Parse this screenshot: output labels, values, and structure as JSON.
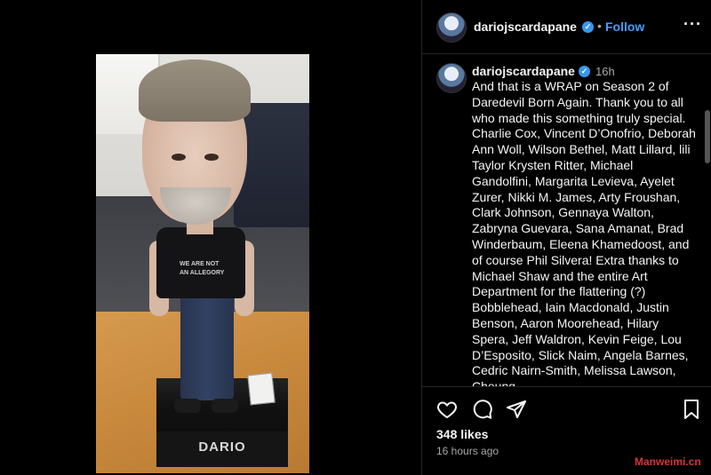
{
  "post": {
    "username": "dariojscardapane",
    "follow_label": "Follow",
    "separator": "•",
    "caption_time": "16h",
    "caption": "And that is a WRAP on Season 2 of Daredevil Born Again.  Thank you to all who made this something truly special.  Charlie Cox, Vincent D’Onofrio, Deborah Ann Woll, Wilson Bethel, Matt Lillard, lili Taylor  Krysten Ritter, Michael Gandolfini, Margarita Levieva, Ayelet Zurer, Nikki M. James, Arty Froushan, Clark Johnson, Gennaya Walton, Zabryna Guevara, Sana Amanat, Brad Winderbaum, Eleena Khamedoost, and of course Phil Silvera!  Extra thanks to Michael Shaw and the entire Art Department for the flattering (?) Bobblehead, Iain Macdonald, Justin Benson, Aaron Moorehead, Hilary Spera, Jeff Waldron, Kevin Feige, Lou D’Esposito, Slick Naim, Angela Barnes, Cedric Nairn-Smith, Melissa Lawson, Cheung",
    "likes": "348 likes",
    "posted": "16 hours ago"
  },
  "photo": {
    "base_label": "DARIO",
    "shirt_text_line1": "WE ARE NOT",
    "shirt_text_line2": "AN ALLEGORY"
  },
  "actions": {
    "like_icon": "heart-icon",
    "comment_icon": "comment-icon",
    "share_icon": "paper-plane-icon",
    "save_icon": "bookmark-icon"
  },
  "watermark": "Manweimi.cn",
  "colors": {
    "background": "#000000",
    "follow": "#4a9bff",
    "verified": "#3897f0",
    "muted": "#a8a8a8"
  }
}
